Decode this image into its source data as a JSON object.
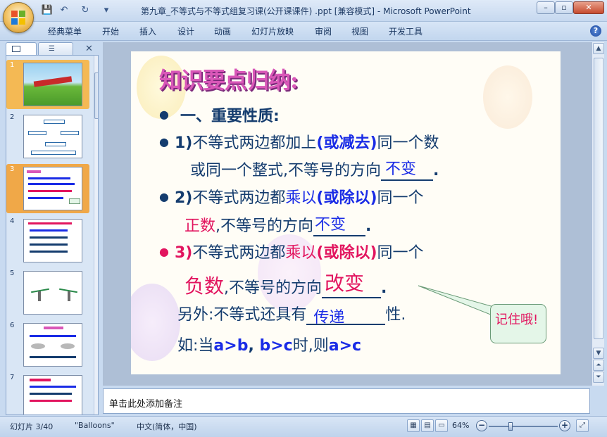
{
  "window": {
    "title": "第九章_不等式与不等式组复习课(公开课课件) .ppt [兼容模式] - Microsoft PowerPoint",
    "minimize": "–",
    "restore": "▫",
    "close": "✕"
  },
  "ribbon": {
    "tabs": [
      "经典菜单",
      "开始",
      "插入",
      "设计",
      "动画",
      "幻灯片放映",
      "审阅",
      "视图",
      "开发工具"
    ]
  },
  "slides_panel": {
    "close": "✕",
    "slide_numbers": [
      "1",
      "2",
      "3",
      "4",
      "5",
      "6",
      "7"
    ],
    "selected": 3
  },
  "slide": {
    "title": "知识要点归纳:",
    "line1": "一、重要性质:",
    "p1_num": "1)",
    "p1_a": "不等式两边都加上",
    "p1_b": "(或减去)",
    "p1_c": "同一个数",
    "p1_d": "或同一个整式,不等号的方向",
    "p1_fill": "不变",
    "p2_num": "2)",
    "p2_a": "不等式两边都",
    "p2_b": "乘以",
    "p2_c": "(或除以)",
    "p2_d": "同一个",
    "p2_e": "正数",
    "p2_f": ",不等号的方向",
    "p2_fill": "不变",
    "p3_num": "3)",
    "p3_a": "不等式两边都",
    "p3_b": "乘以",
    "p3_c": "(或除以)",
    "p3_d": "同一个",
    "p3_e": "负数",
    "p3_f": ",不等号的方向",
    "p3_fill": "改变",
    "extra_a": "另外:不等式还具有",
    "extra_fill": "传递",
    "extra_b": "性.",
    "example_a": "如:当",
    "example_b": "a>b",
    "example_c": ", ",
    "example_d": "b>c",
    "example_e": "时,则",
    "example_f": "a>c",
    "period": ".",
    "callout": "记住哦!"
  },
  "notes": {
    "placeholder": "单击此处添加备注"
  },
  "status": {
    "slide": "幻灯片 3/40",
    "theme": "\"Balloons\"",
    "language": "中文(简体，中国)",
    "zoom": "64%",
    "zoom_fraction": 0.64
  }
}
